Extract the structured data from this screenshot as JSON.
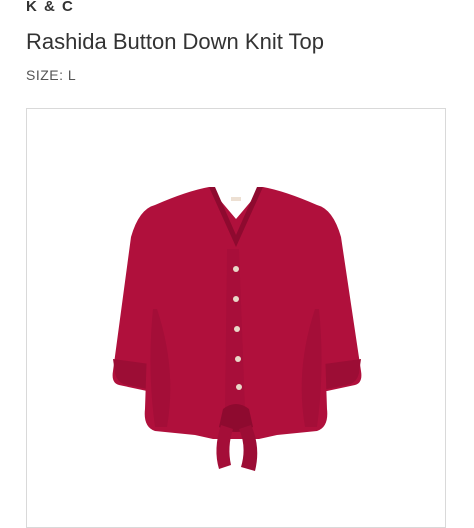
{
  "product": {
    "brand": "K & C",
    "name": "Rashida Button Down Knit Top",
    "size_label": "SIZE: L"
  },
  "image": {
    "garment_color": "#b0103c",
    "shade_color": "#8e0a2f",
    "button_color": "#e8d8c8",
    "buttons": 5
  }
}
